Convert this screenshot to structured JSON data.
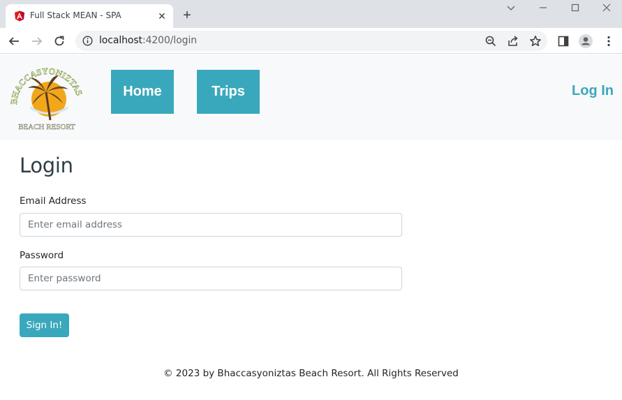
{
  "browser": {
    "tab_title": "Full Stack MEAN - SPA",
    "tab_close": "✕",
    "new_tab": "+",
    "url_host": "localhost",
    "url_path": ":4200/login",
    "icons": [
      "angular-favicon",
      "back-icon",
      "forward-icon",
      "reload-icon",
      "info-icon",
      "zoom-icon",
      "share-icon",
      "star-icon",
      "sidepanel-icon",
      "profile-icon",
      "menu-icon"
    ]
  },
  "header": {
    "logo_text_top": "BHACCASYONIZTAS",
    "logo_text_bottom": "BEACH RESORT",
    "nav": [
      {
        "label": "Home"
      },
      {
        "label": "Trips"
      }
    ],
    "login_link": "Log In"
  },
  "form": {
    "title": "Login",
    "email_label": "Email Address",
    "email_placeholder": "Enter email address",
    "password_label": "Password",
    "password_placeholder": "Enter password",
    "submit_label": "Sign In!"
  },
  "footer": {
    "text": "© 2023 by Bhaccasyoniztas Beach Resort. All Rights Reserved"
  },
  "colors": {
    "accent": "#3aa8bc",
    "header_bg": "#f8f9fa",
    "title": "#2e3e48"
  }
}
